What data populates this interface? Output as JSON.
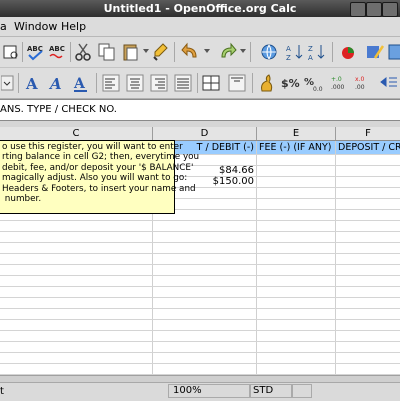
{
  "window": {
    "title": "Untitled1 - OpenOffice.org Calc"
  },
  "menu": {
    "items": [
      "a",
      "Window",
      "Help"
    ]
  },
  "formula": {
    "content": "ANS. TYPE / CHECK NO."
  },
  "columns": {
    "c": "C",
    "d": "D",
    "e": "E",
    "f": "F"
  },
  "sheet": {
    "header_row": {
      "d": "T / DEBIT (-)",
      "e": "FEE (-) (IF ANY)",
      "f": "DEPOSIT / CR"
    },
    "values": [
      "$84.66",
      "$150.00"
    ]
  },
  "comment": {
    "text": "o use this register, you will want to enter\nrting balance in cell G2; then, everytime you\ndebit, fee, and/or deposit your '$ BALANCE'\nmagically adjust. Also you will want to go:\nHeaders & Footers, to insert your name and\n number."
  },
  "status": {
    "left": "t",
    "zoom": "100%",
    "mode": "STD"
  }
}
